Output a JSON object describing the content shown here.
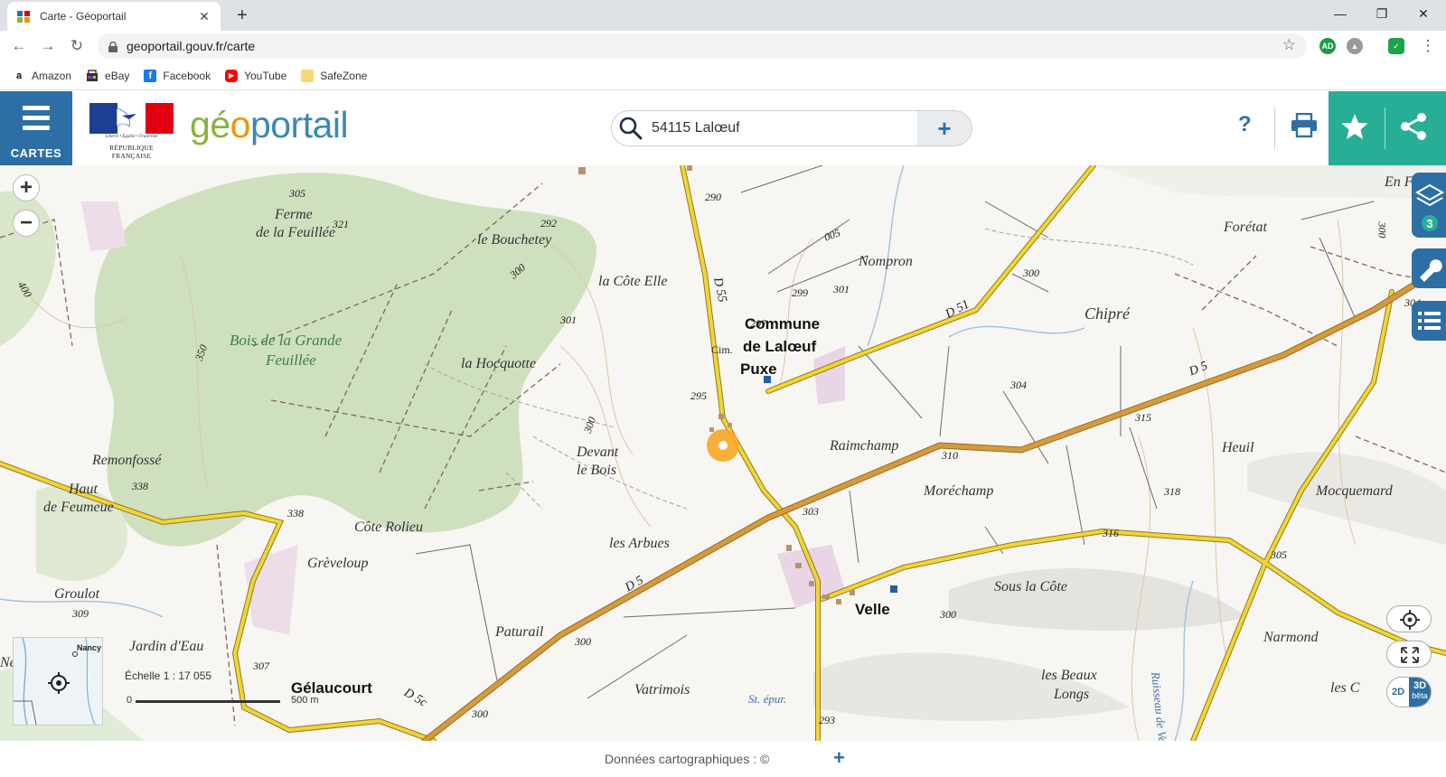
{
  "browser": {
    "tab_title": "Carte - Géoportail",
    "new_tab": "+",
    "url": "geoportail.gouv.fr/carte",
    "bookmarks": [
      {
        "label": "Amazon",
        "icon": "amazon-icon"
      },
      {
        "label": "eBay",
        "icon": "ebay-icon"
      },
      {
        "label": "Facebook",
        "icon": "facebook-icon"
      },
      {
        "label": "YouTube",
        "icon": "youtube-icon"
      },
      {
        "label": "SafeZone",
        "icon": "folder-icon"
      }
    ],
    "extensions": [
      "AD"
    ]
  },
  "header": {
    "menu_label": "CARTES",
    "logo_motto": "Liberté • Égalité • Fraternité",
    "logo_rep": "RÉPUBLIQUE FRANÇAISE",
    "brand_g": "g",
    "brand_e": "é",
    "brand_o": "o",
    "brand_rest": "portail",
    "search_value": "54115 Lalœuf",
    "help": "?"
  },
  "colors": {
    "primary_blue": "#2d6fa4",
    "teal": "#27ae96",
    "road_yellow": "#f2d534",
    "road_orange": "#d49a3c",
    "forest": "#cfe0bf"
  },
  "map": {
    "layer_count": "3",
    "btn_2d": "2D",
    "btn_3d": "3D",
    "btn_beta": "bêta",
    "zoom_in": "+",
    "zoom_out": "−",
    "overview_city": "Nancy",
    "scale_label": "Échelle 1 : 17 055",
    "scale_start": "0",
    "scale_end": "500 m",
    "places": [
      "Ferme",
      "de la Feuillée",
      "le Bouchetey",
      "la Côte Elle",
      "Nompron",
      "Forétat",
      "Chipré",
      "Commune",
      "de Lalœuf",
      "Puxe",
      "Cim.",
      "la Hocquotte",
      "Raimchamp",
      "Heuil",
      "Devant",
      "le Bois",
      "Remonfossé",
      "Haut",
      "de Feumeue",
      "Moréchamp",
      "Mocquemard",
      "Côte Rolieu",
      "Grèveloup",
      "les Arbues",
      "Sous la Côte",
      "Velle",
      "Groulot",
      "Jardin d'Eau",
      "Paturail",
      "Narmond",
      "Gélaucourt",
      "Vatrimois",
      "St. épur.",
      "les Beaux",
      "Longs",
      "les C",
      "En F",
      "Bois de la Grande",
      "Feuillée",
      "Ruisseau de Velle",
      "Ne"
    ],
    "altitudes": [
      "305",
      "321",
      "292",
      "290",
      "299",
      "301",
      "300",
      "300",
      "297",
      "301",
      "295",
      "304",
      "315",
      "310",
      "338",
      "338",
      "303",
      "318",
      "316",
      "305",
      "309",
      "307",
      "300",
      "293",
      "304",
      "300",
      "300",
      "350",
      "400",
      "300",
      "300",
      "005"
    ],
    "roads": [
      "D 55",
      "D 51",
      "D 5",
      "D 5",
      "D 5c"
    ]
  },
  "footer": {
    "credit": "Données cartographiques : ©",
    "plus": "+"
  }
}
